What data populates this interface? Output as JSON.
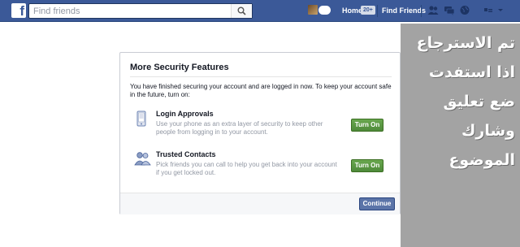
{
  "topbar": {
    "logo_letter": "f",
    "search_placeholder": "Find friends",
    "home_label": "Home",
    "home_count": "20+",
    "find_friends_label": "Find Friends",
    "icons": [
      "friend-requests-icon",
      "messages-icon",
      "notifications-icon",
      "privacy-icon"
    ]
  },
  "dialog": {
    "title": "More Security Features",
    "intro": "You have finished securing your account and are logged in now. To keep your account safe in the future, turn on:",
    "features": [
      {
        "title": "Login Approvals",
        "description": "Use your phone as an extra layer of security to keep other people from logging in to your account.",
        "button": "Turn On",
        "icon": "phone-icon"
      },
      {
        "title": "Trusted Contacts",
        "description": "Pick friends you can call to help you get back into your account if you get locked out.",
        "button": "Turn On",
        "icon": "contacts-icon"
      }
    ],
    "continue_label": "Continue"
  },
  "overlay": {
    "lines": [
      "تم الاسترجاع",
      "اذا استفدت",
      "ضع تعليق",
      "وشارك",
      "الموضوع"
    ]
  },
  "colors": {
    "brand_blue": "#3b5998",
    "button_green": "#4e8a3a",
    "overlay_grey": "#a3a3a3"
  }
}
